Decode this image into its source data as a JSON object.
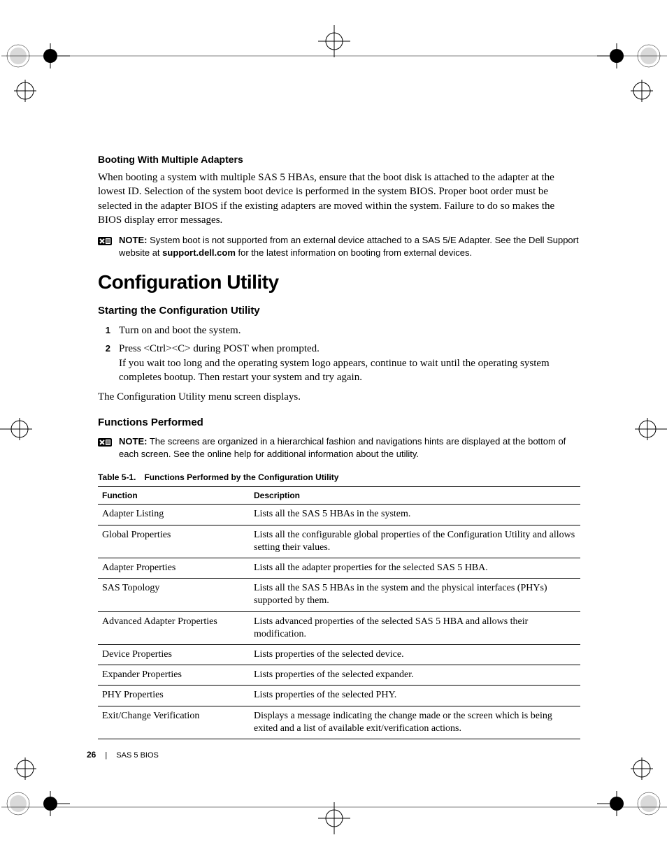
{
  "section_booting": {
    "heading": "Booting With Multiple Adapters",
    "paragraph": "When booting a system with multiple SAS 5 HBAs, ensure that the boot disk is attached to the adapter at the lowest ID. Selection of the system boot device is performed in the system BIOS. Proper boot order must be selected in the adapter BIOS if the existing adapters are moved within the system. Failure to do so makes the BIOS display error messages."
  },
  "note1": {
    "label": "NOTE:",
    "text_a": " System boot is not supported from an external device attached to a SAS 5/E Adapter. See the Dell Support website at ",
    "site": "support.dell.com",
    "text_b": " for the latest information on booting from external devices."
  },
  "config_utility": {
    "title": "Configuration Utility",
    "starting_heading": "Starting the Configuration Utility",
    "steps": [
      {
        "num": "1",
        "text": "Turn on and boot the system."
      },
      {
        "num": "2",
        "text": "Press <Ctrl><C> during POST when prompted.",
        "text2": "If you wait too long and the operating system logo appears, continue to wait until the operating system completes bootup. Then restart your system and try again."
      }
    ],
    "after_steps": "The Configuration Utility menu screen displays.",
    "functions_heading": "Functions Performed"
  },
  "note2": {
    "label": "NOTE:",
    "text": " The screens are organized in a hierarchical fashion and navigations hints are displayed at the bottom of each screen. See the online help for additional information about the utility."
  },
  "table": {
    "caption": "Table 5-1. Functions Performed by the Configuration Utility",
    "col1": "Function",
    "col2": "Description",
    "rows": [
      {
        "f": "Adapter Listing",
        "d": "Lists all the SAS 5 HBAs in the system."
      },
      {
        "f": "Global Properties",
        "d": "Lists all the configurable global properties of the Configuration Utility and allows setting their values."
      },
      {
        "f": "Adapter Properties",
        "d": "Lists all the adapter properties for the selected SAS 5 HBA."
      },
      {
        "f": "SAS Topology",
        "d": "Lists all the SAS 5 HBAs in the system and the physical interfaces (PHYs) supported by them."
      },
      {
        "f": "Advanced Adapter Properties",
        "d": "Lists advanced properties of the selected SAS 5 HBA and allows their modification."
      },
      {
        "f": "Device Properties",
        "d": "Lists properties of the selected device."
      },
      {
        "f": "Expander Properties",
        "d": "Lists properties of the selected expander."
      },
      {
        "f": "PHY Properties",
        "d": "Lists properties of the selected PHY."
      },
      {
        "f": "Exit/Change Verification",
        "d": "Displays a message indicating the change made or the screen which is being exited and a list of available exit/verification actions."
      }
    ]
  },
  "footer": {
    "page": "26",
    "section": "SAS 5 BIOS"
  }
}
